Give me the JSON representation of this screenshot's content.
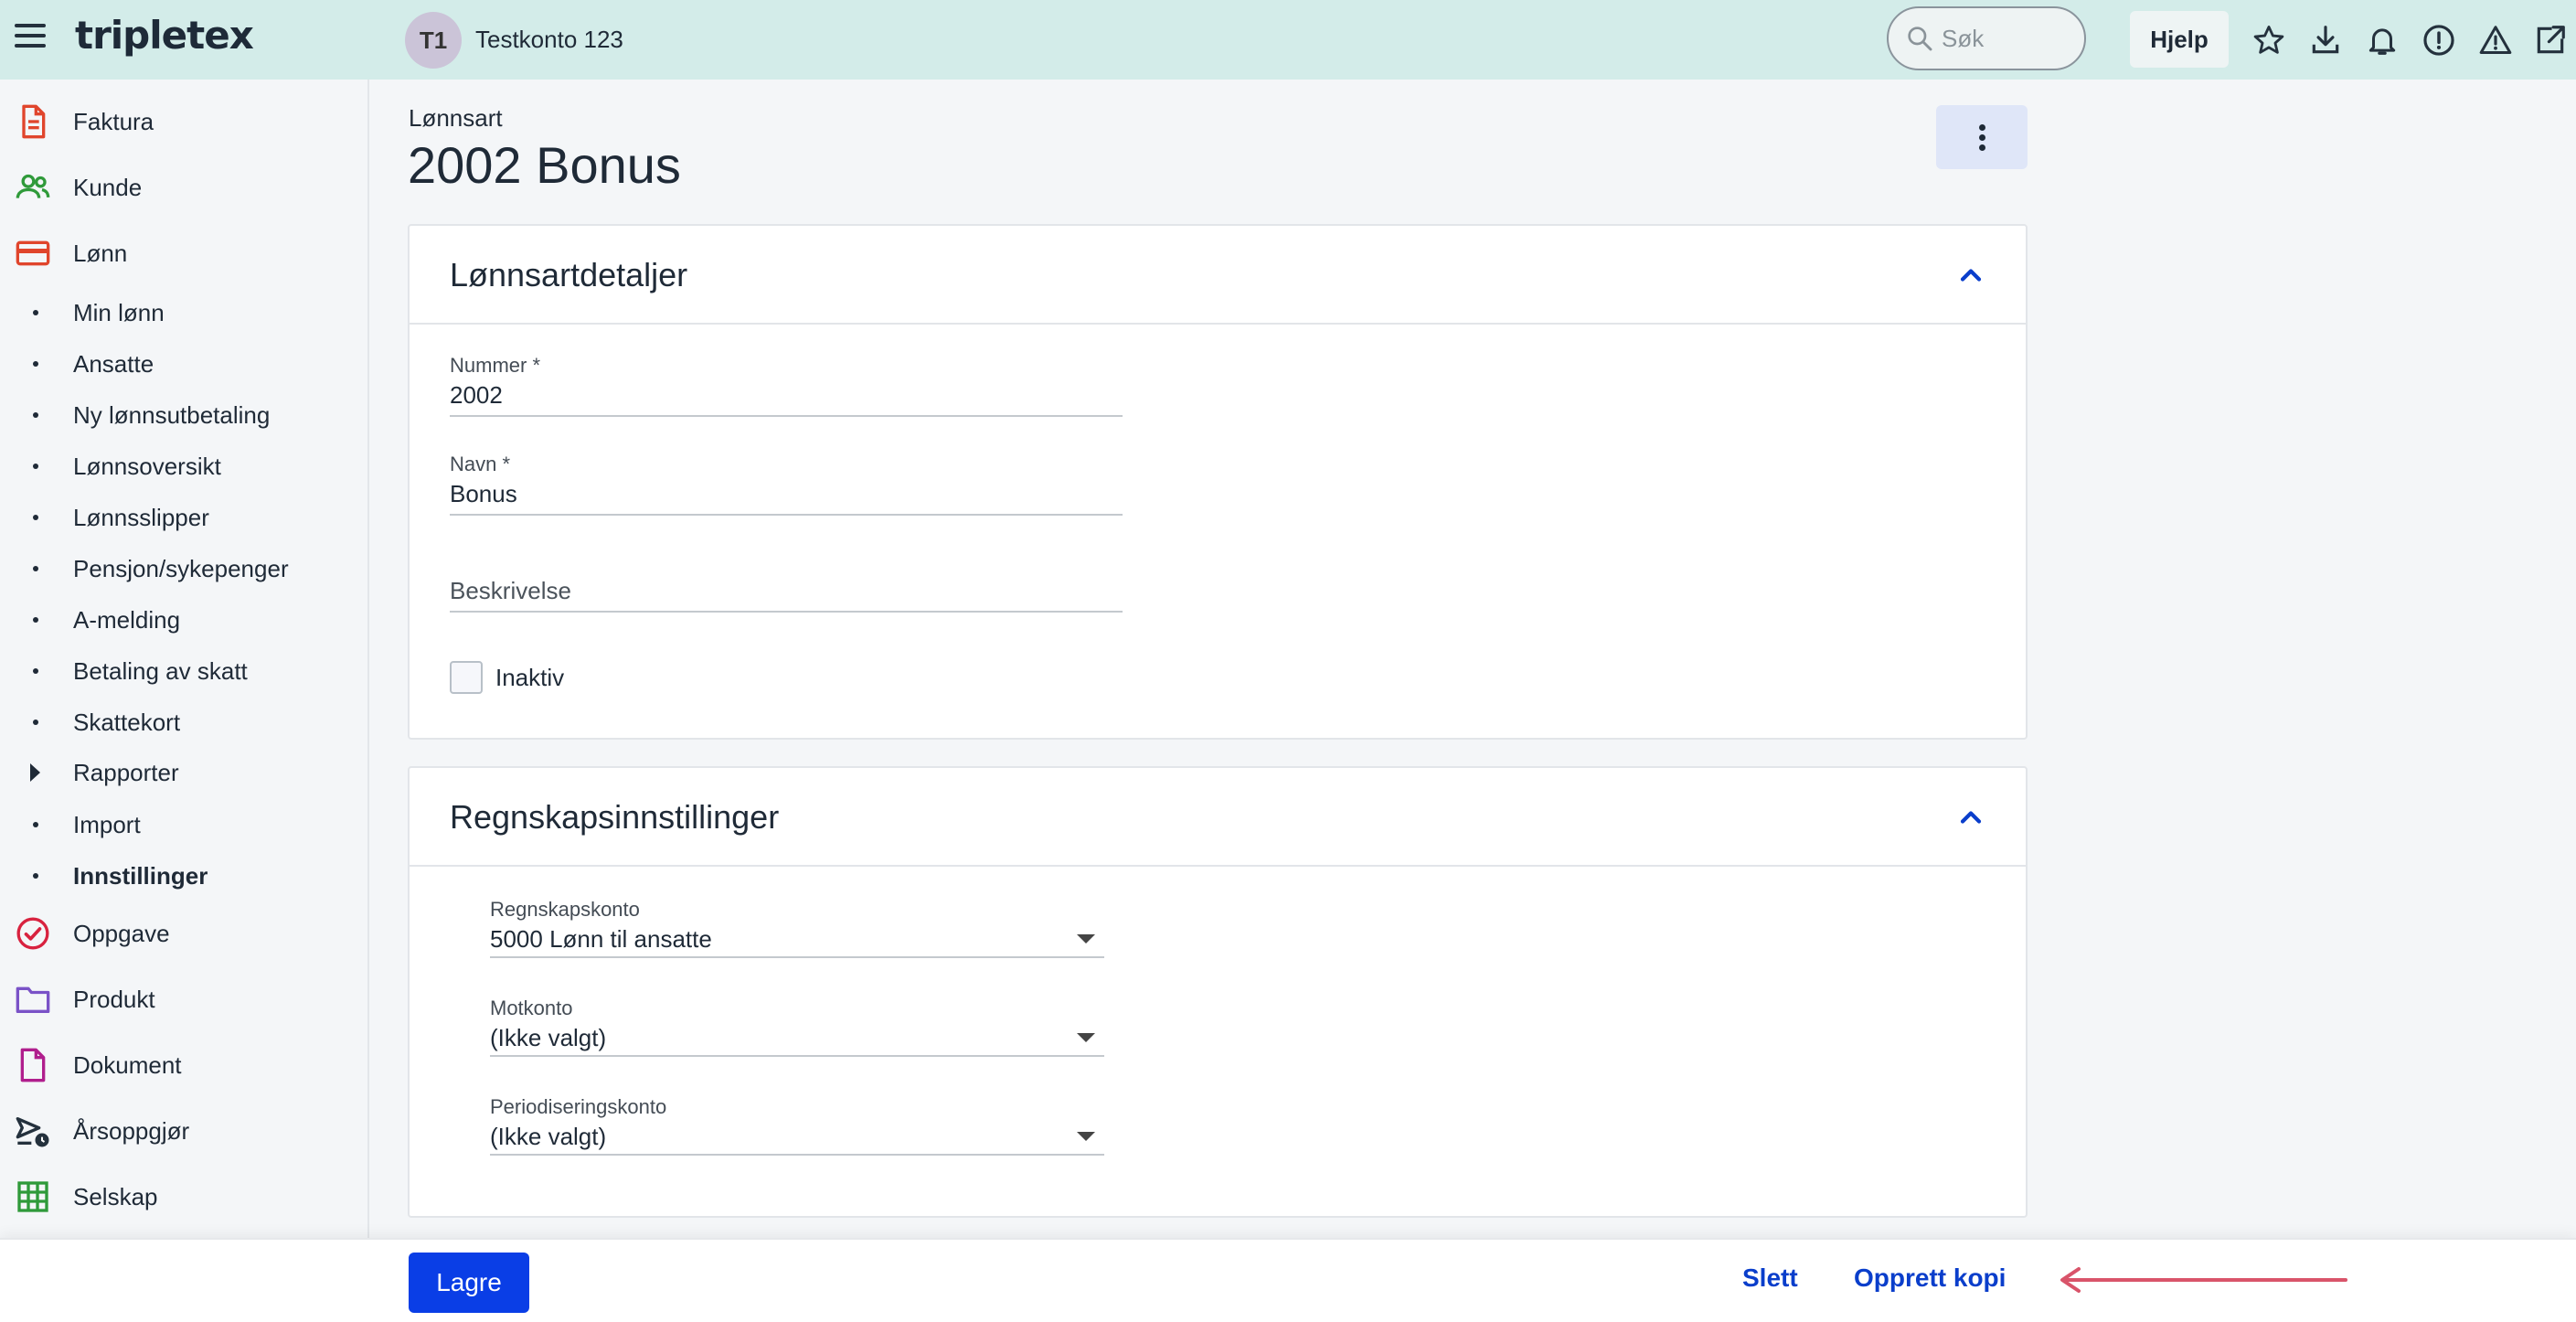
{
  "topbar": {
    "logo": "tripletex",
    "account_initials": "T1",
    "account_name": "Testkonto 123",
    "search_placeholder": "Søk",
    "help_label": "Hjelp",
    "icons": [
      "star-icon",
      "download-icon",
      "bell-icon",
      "alert-circle-icon",
      "warning-icon",
      "external-link-icon"
    ]
  },
  "sidebar": {
    "items": [
      {
        "label": "Faktura",
        "icon": "invoice-icon",
        "color": "#e0452c"
      },
      {
        "label": "Kunde",
        "icon": "customers-icon",
        "color": "#2f9a3a"
      },
      {
        "label": "Lønn",
        "icon": "payroll-card-icon",
        "color": "#e0452c"
      }
    ],
    "payroll_sub": [
      {
        "label": "Min lønn"
      },
      {
        "label": "Ansatte"
      },
      {
        "label": "Ny lønnsutbetaling"
      },
      {
        "label": "Lønnsoversikt"
      },
      {
        "label": "Lønnsslipper"
      },
      {
        "label": "Pensjon/sykepenger"
      },
      {
        "label": "A-melding"
      },
      {
        "label": "Betaling av skatt"
      },
      {
        "label": "Skattekort"
      },
      {
        "label": "Rapporter",
        "expandable": true
      },
      {
        "label": "Import"
      },
      {
        "label": "Innstillinger",
        "active": true
      }
    ],
    "items_after": [
      {
        "label": "Oppgave",
        "icon": "task-check-icon",
        "color": "#d8223f"
      },
      {
        "label": "Produkt",
        "icon": "folder-icon",
        "color": "#7a52c7"
      },
      {
        "label": "Dokument",
        "icon": "document-icon",
        "color": "#b01e8d"
      },
      {
        "label": "Årsoppgjør",
        "icon": "year-end-icon",
        "color": "#24313d"
      },
      {
        "label": "Selskap",
        "icon": "company-grid-icon",
        "color": "#2f9a3a"
      }
    ]
  },
  "page": {
    "breadcrumb": "Lønnsart",
    "title": "2002 Bonus"
  },
  "details": {
    "title": "Lønnsartdetaljer",
    "number_label": "Nummer *",
    "number_value": "2002",
    "name_label": "Navn *",
    "name_value": "Bonus",
    "description_placeholder": "Beskrivelse",
    "inactive_label": "Inaktiv",
    "inactive_checked": false
  },
  "accounting": {
    "title": "Regnskapsinnstillinger",
    "account_label": "Regnskapskonto",
    "account_value": "5000 Lønn til ansatte",
    "counter_label": "Motkonto",
    "counter_value": "(Ikke valgt)",
    "accrual_label": "Periodiseringskonto",
    "accrual_value": "(Ikke valgt)"
  },
  "footer": {
    "save_label": "Lagre",
    "delete_label": "Slett",
    "copy_label": "Opprett kopi"
  },
  "colors": {
    "topbar_bg": "#d3ece9",
    "primary": "#0a3ee6",
    "link": "#0a3ecb",
    "annotation_arrow": "#d9546a"
  }
}
